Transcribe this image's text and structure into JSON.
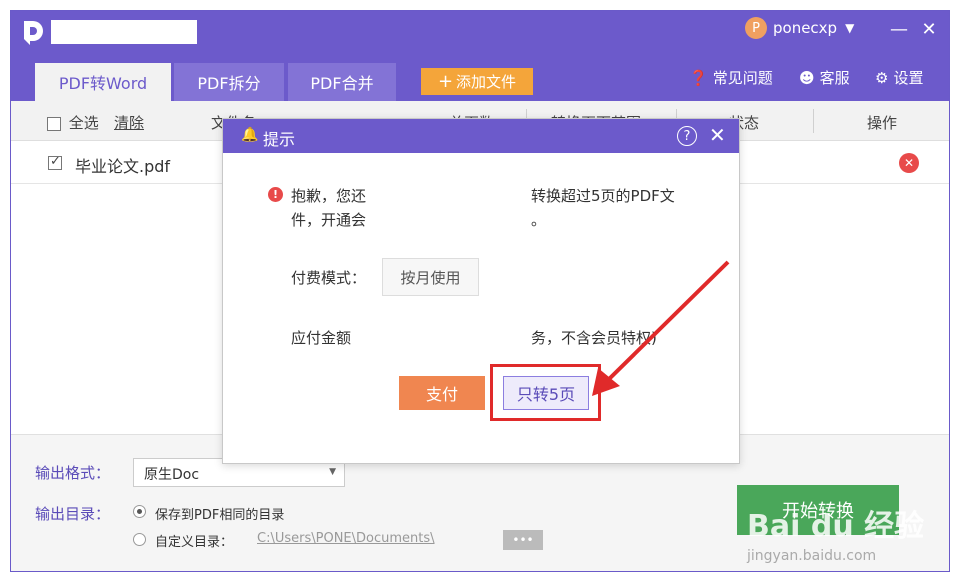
{
  "header": {
    "user_initial": "P",
    "username": "ponecxp",
    "minimize": "—",
    "close": "✕"
  },
  "tabs": [
    {
      "label": "PDF转Word",
      "active": true
    },
    {
      "label": "PDF拆分",
      "active": false
    },
    {
      "label": "PDF合并",
      "active": false
    }
  ],
  "toolbar": {
    "add_file": "添加文件",
    "faq": "常见问题",
    "service": "客服",
    "settings": "设置"
  },
  "table": {
    "select_all": "全选",
    "clear": "清除",
    "columns": [
      "文件名",
      "总页数",
      "转换页面范围",
      "状态",
      "操作"
    ]
  },
  "file": {
    "name": "毕业论文.pdf",
    "checked": true
  },
  "output": {
    "format_label": "输出格式：",
    "format_value": "原生Doc",
    "dir_label": "输出目录：",
    "option_same": "保存到PDF相同的目录",
    "option_custom": "自定义目录：",
    "custom_path": "C:\\Users\\PONE\\Documents\\",
    "more": "•••",
    "start": "开始转换"
  },
  "dialog": {
    "title": "提示",
    "help": "?",
    "close": "✕",
    "msg_line1_a": "抱歉，您还",
    "msg_line1_b": "转换超过5页的PDF文",
    "msg_line2_a": "件，开通会",
    "msg_line2_b": "。",
    "pay_mode_label": "付费模式：",
    "pay_mode_value": "按月使用",
    "amount_label": "应付金额",
    "amount_note": "务，不含会员特权)",
    "pay_button": "支付",
    "five_page_button": "只转5页"
  },
  "watermark": {
    "brand": "Bai du 经验",
    "url": "jingyan.baidu.com"
  },
  "colors": {
    "primary": "#6c5acb",
    "accent_orange": "#f4a53a",
    "pay_orange": "#f08650",
    "highlight_red": "#e02a2a",
    "start_green": "#4aa75a"
  }
}
